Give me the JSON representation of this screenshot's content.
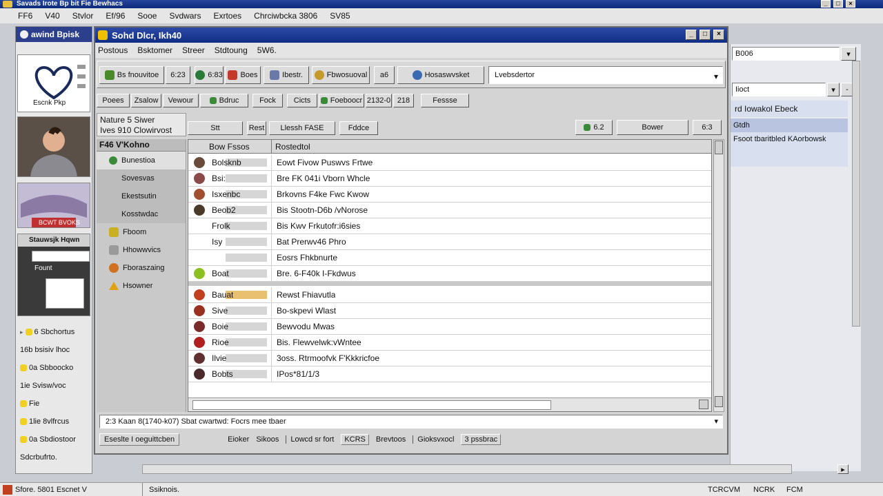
{
  "outer": {
    "title": "Savads Irote Bp bit Fie Bewhacs",
    "menu": [
      "FF6",
      "V40",
      "Stvlor",
      "Ef/96",
      "Sooe",
      "Svdwars",
      "Exrtoes",
      "Chrciwbcka 3806",
      "SV85"
    ],
    "status_left": "Sfore. 5801 Escnet V",
    "status_mid": "Ssiknois.",
    "status_right": [
      "TCRCVM",
      "NCRK",
      "FCM"
    ]
  },
  "left_panel": {
    "title": "awind Bpisk",
    "logo_caption": "Escnk Pkp",
    "photo_caption": "BCWT BVOKS",
    "mini_caption": "Stauwsjk Hqwn",
    "mini_line": "Fount",
    "tree": [
      "6 Sbchortus",
      "16b bsisiv lhoc",
      "0a Sbboocko",
      "1ie Svisw/voc",
      "Fie",
      "1lie 8vlfrcus",
      "0a Sbdiostoor",
      "Sdcrbufrto."
    ]
  },
  "main": {
    "title": "Sohd Dlcr, Ikh40",
    "menu": [
      "Postous",
      "Bsktomer",
      "Streer",
      "Stdtoung",
      "5W6."
    ],
    "toolbar": [
      {
        "icon": "leaf-icon",
        "label": "Bs fnouvitoe",
        "color": "#4a8a2a"
      },
      {
        "icon": "",
        "label": "6:23",
        "color": ""
      },
      {
        "icon": "gear-icon",
        "label": "6:83",
        "color": "#2a7a3a"
      },
      {
        "icon": "flag-icon",
        "label": "Boes",
        "color": "#c43a2a"
      },
      {
        "icon": "page-icon",
        "label": "Ibestr.",
        "color": "#6a7aa8"
      },
      {
        "icon": "smiley-icon",
        "label": "Fbwosuoval",
        "color": "#c49a2a"
      },
      {
        "icon": "",
        "label": "a6",
        "color": ""
      },
      {
        "icon": "globe-icon",
        "label": "Hosaswvsket",
        "color": "#3a6ab0"
      }
    ],
    "search": {
      "value": "Lvebsdertor"
    },
    "tabs": [
      "Poees",
      "Zsalow",
      "Vewour",
      "Bdruc",
      "Fock",
      "Cicts",
      "Foeboocr",
      "2132-0",
      "218",
      "Fessse"
    ],
    "sub_tabs": [
      "Nature 5 Siwer",
      "Ives 910 Clowirvost"
    ],
    "action_buttons": [
      "Stt",
      "Rest",
      "Llessh FASE",
      "Fddce"
    ],
    "right_buttons": [
      "6.2",
      "Bower",
      "6:3"
    ],
    "tree_head": "F46 V'Kohno",
    "nav": [
      {
        "label": "Bunestioa",
        "icon": "leaf-icon",
        "color": "#3a8a3a",
        "active": true
      },
      {
        "label": "Sovesvas",
        "icon": "",
        "color": "",
        "active": false
      },
      {
        "label": "Ekestsutin",
        "icon": "",
        "color": "",
        "active": false
      },
      {
        "label": "Kosstwdac",
        "icon": "",
        "color": "",
        "active": false
      },
      {
        "label": "Fboom",
        "icon": "folder-icon",
        "color": "#c8b020",
        "active": false
      },
      {
        "label": "Hhowwvics",
        "icon": "",
        "color": "",
        "active": false
      },
      {
        "label": "Fboraszaing",
        "icon": "person-icon",
        "color": "#d07020",
        "active": false
      },
      {
        "label": "Hsowner",
        "icon": "warning-icon",
        "color": "#e0a010",
        "active": false
      }
    ],
    "columns": [
      "Bow Fssos",
      "Rostedtol"
    ],
    "rows": [
      {
        "name": "Bolsknb",
        "desc": "Eowt Fivow Puswvs Frtwe",
        "avatar": "#6a4a3a",
        "highlight": false
      },
      {
        "name": "Bsi:",
        "desc": "Bre FK 041i Vborn Whcle",
        "avatar": "#8a4a4a",
        "highlight": false
      },
      {
        "name": "Isxenbc",
        "desc": "Brkovns F4ke Fwc Kwow",
        "avatar": "#a05030",
        "highlight": false
      },
      {
        "name": "Beob2",
        "desc": "Bis Stootn-D6b /vNorose",
        "avatar": "#4a3a2a",
        "highlight": false
      },
      {
        "name": "Frolk",
        "desc": "Bis Kwv Frkutofr:i6sies",
        "avatar": "",
        "highlight": false
      },
      {
        "name": "Isy",
        "desc": "Bat Prerwv46 Phro",
        "avatar": "",
        "highlight": false
      },
      {
        "name": "",
        "desc": "Eosrs Fhkbnurte",
        "avatar": "",
        "highlight": false
      },
      {
        "name": "Boat",
        "desc": "Bre. 6-F40k I-Fkdwus",
        "avatar": "#8ac020",
        "highlight": false
      },
      {
        "name": "Bauat",
        "desc": "Rewst Fhiavutla",
        "avatar": "#c04020",
        "highlight": true
      },
      {
        "name": "Sive",
        "desc": "Bo-skpevi Wlast",
        "avatar": "#9a3020",
        "highlight": false
      },
      {
        "name": "Boie",
        "desc": "Bewvodu Mwas",
        "avatar": "#7a2a2a",
        "highlight": false
      },
      {
        "name": "Rioe",
        "desc": "Bis. Flewvelwk:vWntee",
        "avatar": "#b02020",
        "highlight": false
      },
      {
        "name": "Ilvie",
        "desc": "3oss. Rtrmoofvk F'Kkkricfoe",
        "avatar": "#603030",
        "highlight": false
      },
      {
        "name": "Bobts",
        "desc": "IPos*81/1/3",
        "avatar": "#4a2a2a",
        "highlight": false
      }
    ],
    "status_line": "2:3 Kaan 8(1740-k07) Sbat cwartwd: Focrs mee tbaer",
    "bottom_left": "Eseslte I oeguittcben",
    "bottom_items": [
      "Eioker",
      "Sikoos",
      "Lowcd sr fort",
      "KCRS",
      "Brevtoos",
      "Gioksvxocl",
      "3 pssbrac"
    ]
  },
  "right_panel": {
    "field1": "B006",
    "field2": "Iioct",
    "line1": "rd Iowakol Ebeck",
    "line2": "Gtdh",
    "line3": "Fsoot tbaritbled KAorbowsk"
  }
}
